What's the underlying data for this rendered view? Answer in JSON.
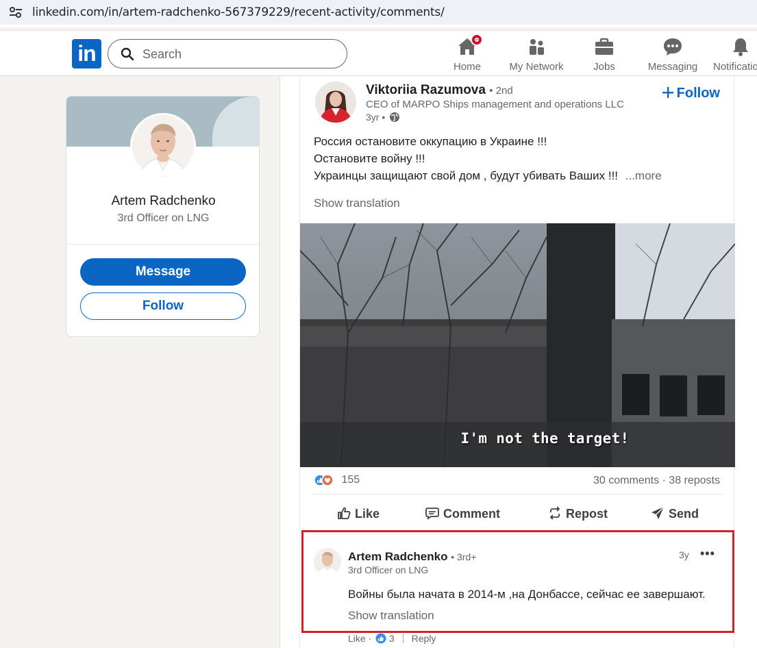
{
  "browser": {
    "url": "linkedin.com/in/artem-radchenko-567379229/recent-activity/comments/"
  },
  "nav": {
    "logo": "in",
    "search_placeholder": "Search",
    "items": [
      {
        "label": "Home",
        "icon": "home-icon"
      },
      {
        "label": "My Network",
        "icon": "network-icon"
      },
      {
        "label": "Jobs",
        "icon": "briefcase-icon"
      },
      {
        "label": "Messaging",
        "icon": "messaging-icon"
      },
      {
        "label": "Notifications",
        "icon": "bell-icon"
      }
    ]
  },
  "profile": {
    "name": "Artem Radchenko",
    "headline": "3rd Officer on LNG",
    "message_label": "Message",
    "follow_label": "Follow"
  },
  "post": {
    "author": "Viktoriia Razumova",
    "degree": "• 2nd",
    "headline": "CEO of MARPO Ships management and operations LLC",
    "time": "3yr •",
    "follow_label": "Follow",
    "text_lines": [
      "Россия остановите оккупацию в Украине !!!",
      "Остановите войну !!!",
      "Украинцы защищают свой дом , будут убивать Ваших !!!"
    ],
    "more_label": "...more",
    "show_translation": "Show translation",
    "video_caption": "I'm not the target!",
    "reaction_count": "155",
    "engagement": "30 comments · 38 reposts",
    "actions": {
      "like": "Like",
      "comment": "Comment",
      "repost": "Repost",
      "send": "Send"
    }
  },
  "comment": {
    "author": "Artem Radchenko",
    "degree": "• 3rd+",
    "headline": "3rd Officer on LNG",
    "time": "3y",
    "menu": "•••",
    "text": "Войны была начата в 2014-м ,на Донбассе, сейчас ее завершают.",
    "show_translation": "Show translation",
    "like_label": "Like ·",
    "like_count": "3",
    "reply_label": "Reply"
  },
  "colors": {
    "brand": "#0a66c2",
    "highlight": "#d1222a",
    "notification_badge": "#cb112d"
  }
}
